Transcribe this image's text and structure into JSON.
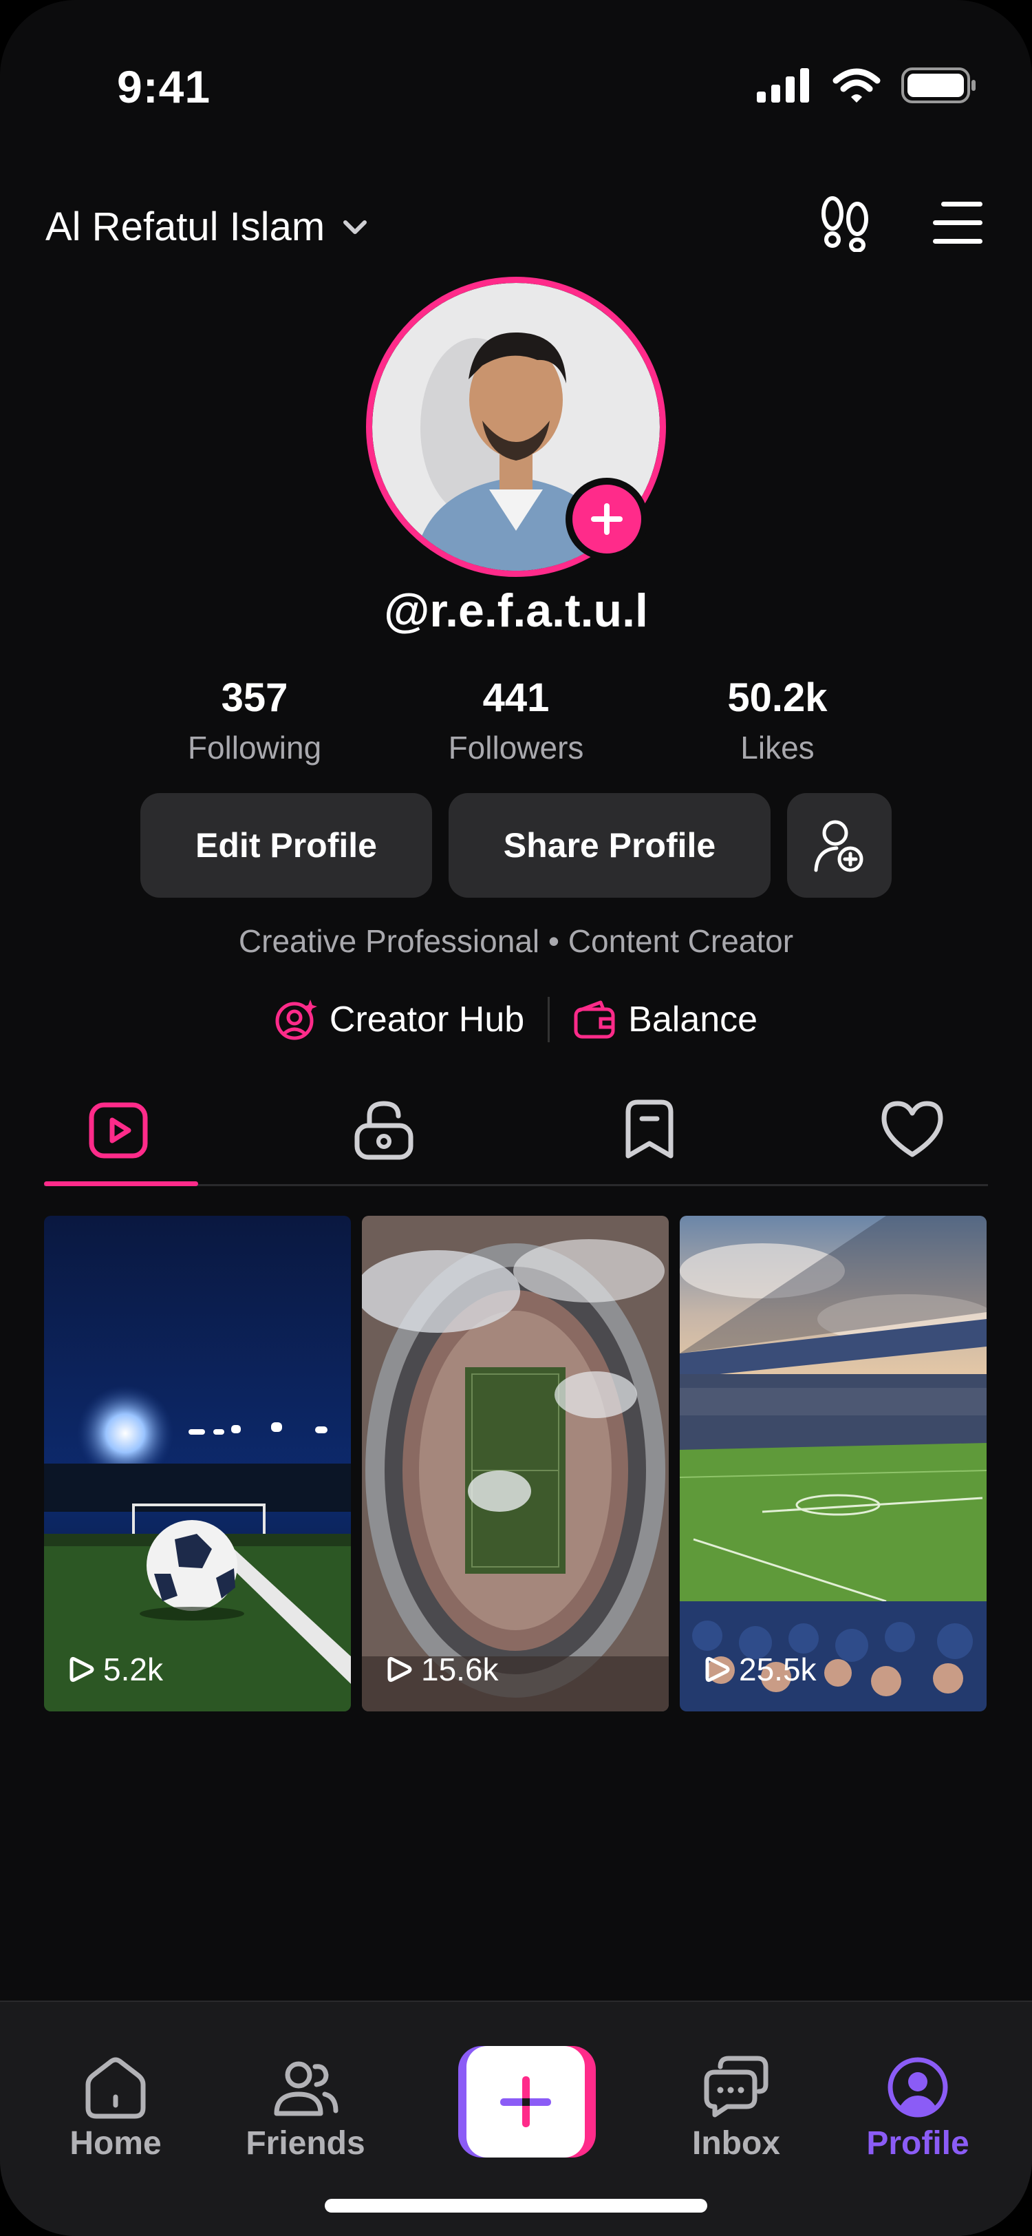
{
  "status": {
    "time": "9:41"
  },
  "header": {
    "name": "Al Refatul Islam"
  },
  "profile": {
    "handle": "@r.e.f.a.t.u.l",
    "stats": [
      {
        "value": "357",
        "label": "Following"
      },
      {
        "value": "441",
        "label": "Followers"
      },
      {
        "value": "50.2k",
        "label": "Likes"
      }
    ],
    "edit_label": "Edit Profile",
    "share_label": "Share Profile",
    "bio": "Creative Professional • Content Creator",
    "links": {
      "creator_hub": "Creator Hub",
      "balance": "Balance"
    }
  },
  "tabs": [
    "videos-icon",
    "private-icon",
    "saved-icon",
    "liked-icon"
  ],
  "videos": [
    {
      "views": "5.2k",
      "scene": "soccer-ball-night"
    },
    {
      "views": "15.6k",
      "scene": "stadium-aerial"
    },
    {
      "views": "25.5k",
      "scene": "stadium-crowd"
    }
  ],
  "nav": {
    "home": "Home",
    "friends": "Friends",
    "inbox": "Inbox",
    "profile": "Profile"
  },
  "colors": {
    "accent": "#ff2b8a",
    "active_nav": "#8b5cf6",
    "background": "#0c0c0d",
    "button": "#2b2b2d"
  }
}
